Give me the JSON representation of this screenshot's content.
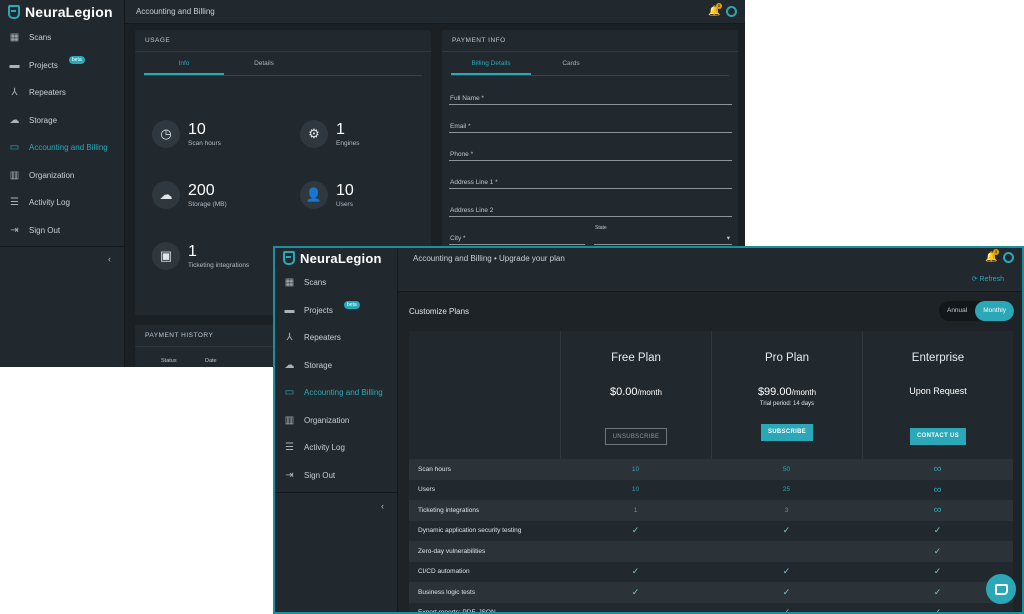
{
  "app": {
    "brand": "NeuraLegion"
  },
  "sidebar": {
    "items": [
      {
        "label": "Scans",
        "icon": "chart-icon"
      },
      {
        "label": "Projects",
        "icon": "folder-icon",
        "badge": "beta"
      },
      {
        "label": "Repeaters",
        "icon": "repeater-icon"
      },
      {
        "label": "Storage",
        "icon": "cloud-icon"
      },
      {
        "label": "Accounting and Billing",
        "icon": "card-icon",
        "active": true
      },
      {
        "label": "Organization",
        "icon": "building-icon"
      },
      {
        "label": "Activity Log",
        "icon": "list-icon"
      },
      {
        "label": "Sign Out",
        "icon": "signout-icon"
      }
    ],
    "collapse_icon": "‹"
  },
  "back": {
    "header_title": "Accounting and Billing",
    "notifications_badge": "5",
    "usage": {
      "title": "USAGE",
      "tabs": [
        "Info",
        "Details"
      ],
      "stats": [
        {
          "value": "10",
          "label": "Scan hours"
        },
        {
          "value": "1",
          "label": "Engines"
        },
        {
          "value": "200",
          "label": "Storage (MB)"
        },
        {
          "value": "10",
          "label": "Users"
        },
        {
          "value": "1",
          "label": "Ticketing integrations"
        }
      ]
    },
    "payment_info": {
      "title": "PAYMENT INFO",
      "tabs": [
        "Billing Details",
        "Cards"
      ],
      "fields": [
        "Full Name *",
        "Email *",
        "Phone *",
        "Address Line 1 *",
        "Address Line 2",
        "City *"
      ],
      "state_label": "State"
    },
    "payment_history": {
      "title": "PAYMENT HISTORY",
      "columns": [
        "Status",
        "Date"
      ]
    }
  },
  "front": {
    "breadcrumb": "Accounting and Billing  •  Upgrade your plan",
    "notifications_badge": "5",
    "refresh_label": "Refresh",
    "plans_title": "Customize Plans",
    "billing_toggle": {
      "options": [
        "Annual",
        "Monthly"
      ],
      "selected": "Monthly"
    },
    "plans": [
      {
        "name": "Free Plan",
        "price": "$0.00",
        "period": "/month",
        "trial": "",
        "button": "UNSUBSCRIBE"
      },
      {
        "name": "Pro Plan",
        "price": "$99.00",
        "period": "/month",
        "trial": "Trial period: 14 days",
        "button": "SUBSCRIBE"
      },
      {
        "name": "Enterprise",
        "price": "Upon Request",
        "period": "",
        "trial": "",
        "button": "CONTACT US"
      }
    ],
    "features": [
      {
        "name": "Scan hours",
        "values": [
          "10",
          "50",
          "∞"
        ]
      },
      {
        "name": "Users",
        "values": [
          "10",
          "25",
          "∞"
        ]
      },
      {
        "name": "Ticketing integrations",
        "values": [
          "1",
          "3",
          "∞"
        ]
      },
      {
        "name": "Dynamic application security testing",
        "values": [
          "✓",
          "✓",
          "✓"
        ]
      },
      {
        "name": "Zero-day vulnerabilities",
        "values": [
          "",
          "",
          "✓"
        ]
      },
      {
        "name": "CI/CD automation",
        "values": [
          "✓",
          "✓",
          "✓"
        ]
      },
      {
        "name": "Business logic tests",
        "values": [
          "✓",
          "✓",
          "✓"
        ]
      },
      {
        "name": "Export reports: PDF, JSON",
        "values": [
          "",
          "✓",
          "✓"
        ]
      }
    ]
  }
}
